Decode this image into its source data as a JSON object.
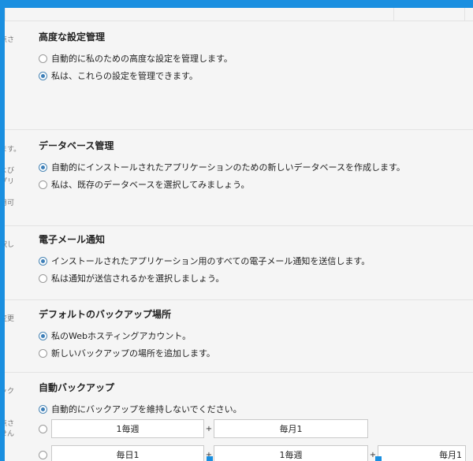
{
  "left_fragments": [
    "点さ",
    "ます。",
    "よび",
    "プリ",
    "用可",
    "択し",
    "変更",
    "ック",
    "点さ",
    "せん"
  ],
  "sections": {
    "advanced": {
      "title": "高度な設定管理",
      "options": [
        {
          "label": "自動的に私のための高度な設定を管理します。",
          "checked": false
        },
        {
          "label": "私は、これらの設定を管理できます。",
          "checked": true
        }
      ]
    },
    "database": {
      "title": "データベース管理",
      "options": [
        {
          "label": "自動的にインストールされたアプリケーションのための新しいデータベースを作成します。",
          "checked": true
        },
        {
          "label": "私は、既存のデータベースを選択してみましょう。",
          "checked": false
        }
      ]
    },
    "email": {
      "title": "電子メール通知",
      "options": [
        {
          "label": "インストールされたアプリケーション用のすべての電子メール通知を送信します。",
          "checked": true
        },
        {
          "label": "私は通知が送信されるかを選択しましょう。",
          "checked": false
        }
      ]
    },
    "backup_location": {
      "title": "デフォルトのバックアップ場所",
      "options": [
        {
          "label": "私のWebホスティングアカウント。",
          "checked": true
        },
        {
          "label": "新しいバックアップの場所を追加します。",
          "checked": false
        }
      ]
    },
    "auto_backup": {
      "title": "自動バックアップ",
      "options": [
        {
          "label": "自動的にバックアップを維持しないでください。",
          "checked": true
        }
      ],
      "schedule_row1": {
        "field1": "1毎週",
        "plus": "+",
        "field2": "毎月1"
      },
      "schedule_row2": {
        "field1": "毎日1",
        "plus1": "+",
        "field2": "1毎週",
        "plus2": "+",
        "field3": "毎月1"
      }
    }
  }
}
